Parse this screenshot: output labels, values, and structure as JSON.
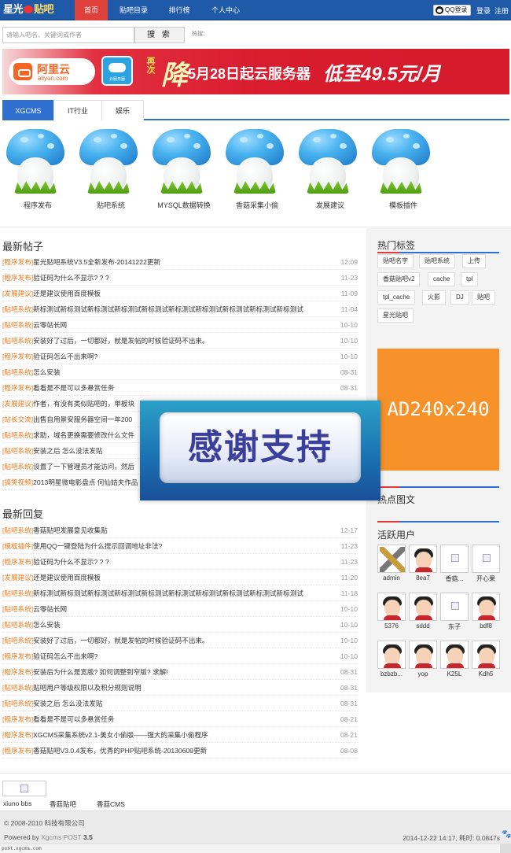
{
  "nav": {
    "logo_part1": "星光",
    "logo_part2": "贴吧",
    "tabs": [
      {
        "label": "首页",
        "active": true
      },
      {
        "label": "贴吧目录"
      },
      {
        "label": "排行榜"
      },
      {
        "label": "个人中心"
      }
    ],
    "qq_login": "QQ登录",
    "login": "登录",
    "register": "注册"
  },
  "search": {
    "placeholder": "请输入吧名、关键词或作者",
    "button": "搜 索",
    "hot_label": "热搜："
  },
  "banner": {
    "brand": "阿里云",
    "brand_domain": "aliyun.com",
    "box_label": "云服务器",
    "promo_small": "再次",
    "promo_big": "降",
    "message": "5月28日起云服务器",
    "price": "低至49.5元/月"
  },
  "category_tabs": [
    {
      "label": "XGCMS",
      "active": true
    },
    {
      "label": "IT行业"
    },
    {
      "label": "娱乐"
    }
  ],
  "forums": [
    {
      "name": "程序发布"
    },
    {
      "name": "贴吧系统"
    },
    {
      "name": "MYSQL数据转换"
    },
    {
      "name": "香菇采集小偷"
    },
    {
      "name": "发展建议"
    },
    {
      "name": "模板插件"
    }
  ],
  "latest_posts": {
    "title": "最新帖子",
    "rows": [
      {
        "cat": "[程序发布]",
        "title": "星光贴吧系统V3.5全新发布-20141222更新",
        "time": "12:09"
      },
      {
        "cat": "[程序发布]",
        "title": "验证码为什么不显示? ? ?",
        "time": "11-23"
      },
      {
        "cat": "[发展建议]",
        "title": "还是建议使用百度模板",
        "time": "11-09"
      },
      {
        "cat": "[贴吧系统]",
        "title": "新标测试新标测试新标测试新标测试新标测试新标测试新标测试新标测试新标测试新标测试",
        "time": "11-04"
      },
      {
        "cat": "[贴吧系统]",
        "title": "云零站长网",
        "time": "10-10"
      },
      {
        "cat": "[贴吧系统]",
        "title": "安装好了过后，一切都好，就是发帖的时候验证码不出来。",
        "time": "10-10"
      },
      {
        "cat": "[程序发布]",
        "title": "验证码怎么不出来啊?",
        "time": "10-10"
      },
      {
        "cat": "[贴吧系统]",
        "title": "怎么安装",
        "time": "08-31"
      },
      {
        "cat": "[程序发布]",
        "title": "看看是不是可以多悬赏任务",
        "time": "08-31"
      },
      {
        "cat": "[发展建议]",
        "title": "作者，有没有类似贴吧的，单板块",
        "time": ""
      },
      {
        "cat": "[站长交流]",
        "title": "出售自用景安服务器空间一年200",
        "time": ""
      },
      {
        "cat": "[贴吧系统]",
        "title": "求助，域名更换需要修改什么文件",
        "time": ""
      },
      {
        "cat": "[贴吧系统]",
        "title": "安装之后 怎么没法发贴",
        "time": ""
      },
      {
        "cat": "[贴吧系统]",
        "title": "设置了一下管理员才能访问，然后",
        "time": ""
      },
      {
        "cat": "[搞笑视频]",
        "title": "2013明星微电影盘点 何仙姑夫作品",
        "time": ""
      }
    ]
  },
  "latest_replies": {
    "title": "最新回复",
    "rows": [
      {
        "cat": "[贴吧系统]",
        "title": "香菇贴吧发展意见收集贴",
        "time": "12-17"
      },
      {
        "cat": "[模板插件]",
        "title": "使用QQ一键登陆为什么提示回调地址非法?",
        "time": "11-23"
      },
      {
        "cat": "[程序发布]",
        "title": "验证码为什么不显示? ? ?",
        "time": "11-23"
      },
      {
        "cat": "[发展建议]",
        "title": "还是建议使用百度模板",
        "time": "11-20"
      },
      {
        "cat": "[贴吧系统]",
        "title": "新标测试新标测试新标测试新标测试新标测试新标测试新标测试新标测试新标测试新标测试",
        "time": "11-18"
      },
      {
        "cat": "[贴吧系统]",
        "title": "云零站长网",
        "time": "10-10"
      },
      {
        "cat": "[贴吧系统]",
        "title": "怎么安装",
        "time": "10-10"
      },
      {
        "cat": "[贴吧系统]",
        "title": "安装好了过后，一切都好，就是发帖的时候验证码不出来。",
        "time": "10-10"
      },
      {
        "cat": "[程序发布]",
        "title": "验证码怎么不出来啊?",
        "time": "10-10"
      },
      {
        "cat": "[程序发布]",
        "title": "安装后为什么是宽版? 如何调整到窄版? 求解!",
        "time": "08-31"
      },
      {
        "cat": "[贴吧系统]",
        "title": "贴吧用户等级权限以及积分规则说明",
        "time": "08-31"
      },
      {
        "cat": "[贴吧系统]",
        "title": "安装之后 怎么没法发贴",
        "time": "08-31"
      },
      {
        "cat": "[程序发布]",
        "title": "看看是不是可以多悬赏任务",
        "time": "08-21"
      },
      {
        "cat": "[程序发布]",
        "title": "XGCMS采集系统v2.1-美女小偷版——强大的采集小偷程序",
        "time": "08-21"
      },
      {
        "cat": "[程序发布]",
        "title": "香菇贴吧V3.0.4发布，优秀的PHP贴吧系统-20130609更新",
        "time": "08-08"
      }
    ]
  },
  "sidebar": {
    "hot_tags_title": "热门标签",
    "tags": [
      "贴吧名字",
      "贴吧系统",
      "上传",
      "香菇贴吧v2",
      "cache",
      "tpl",
      "tpl_cache",
      "火影",
      "DJ",
      "贴吧",
      "星光贴吧"
    ],
    "ad_text": "AD240x240",
    "hot_pics_title": "热点图文",
    "active_users_title": "活跃用户",
    "users": [
      {
        "name": "admin",
        "avatar": "logo"
      },
      {
        "name": "8ea7",
        "avatar": "boy"
      },
      {
        "name": "香菇...",
        "avatar": "broken"
      },
      {
        "name": "开心果",
        "avatar": "broken"
      },
      {
        "name": "5376",
        "avatar": "boy"
      },
      {
        "name": "sddd",
        "avatar": "boy"
      },
      {
        "name": "东子",
        "avatar": "broken"
      },
      {
        "name": "bdf8",
        "avatar": "boy"
      },
      {
        "name": "bzbzb...",
        "avatar": "boy"
      },
      {
        "name": "yop",
        "avatar": "boy"
      },
      {
        "name": "K25L",
        "avatar": "boy"
      },
      {
        "name": "Kdh5",
        "avatar": "boy"
      }
    ]
  },
  "overlay": {
    "text": "感谢支持"
  },
  "footer": {
    "links": [
      "xiuno bbs",
      "香菇贴吧",
      "香菇CMS"
    ],
    "copyright": "© 2008-2010 科技有限公司",
    "powered_prefix": "Powered by",
    "powered_brand": "Xgcms POST",
    "powered_version": "3.5",
    "runtime": "2014-12-22 14:17, 耗时: 0.0847s",
    "status_url": "post.xgcms.com"
  },
  "colors": {
    "nav_bg": "#1f5aa8",
    "nav_active": "#e0403a",
    "accent_blue": "#2f6fcf",
    "category_orange": "#e87a1e",
    "ad_orange": "#f7922b"
  }
}
